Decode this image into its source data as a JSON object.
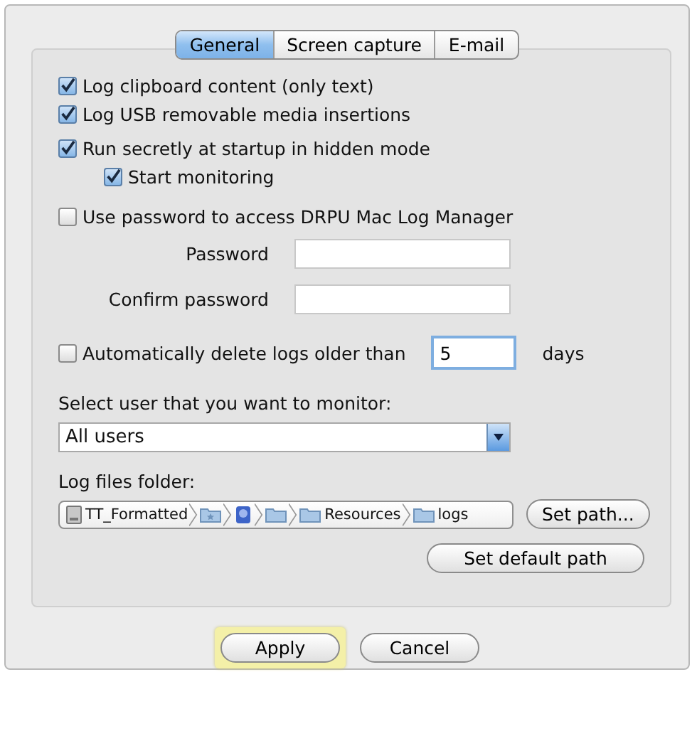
{
  "tabs": [
    {
      "label": "General",
      "selected": true
    },
    {
      "label": "Screen capture",
      "selected": false
    },
    {
      "label": "E-mail",
      "selected": false
    }
  ],
  "options": [
    {
      "label": "Log clipboard content (only text)",
      "checked": true
    },
    {
      "label": "Log USB removable media insertions",
      "checked": true
    },
    {
      "label": "Run secretly at startup in hidden mode",
      "checked": true,
      "children": [
        {
          "label": "Start monitoring",
          "checked": true
        }
      ]
    }
  ],
  "password": {
    "label": "Use password to access DRPU Mac Log Manager",
    "checked": false,
    "fields": [
      {
        "label": "Password"
      },
      {
        "label": "Confirm password"
      }
    ]
  },
  "auto_delete": {
    "label": "Automatically delete logs older than",
    "checked": false,
    "value": "5",
    "unit": "days"
  },
  "user_select": {
    "label": "Select user that you want to monitor:",
    "value": "All users"
  },
  "log_folder": {
    "label": "Log files folder:",
    "path": [
      {
        "kind": "disk",
        "label": "TT_Formatted"
      },
      {
        "kind": "star-folder"
      },
      {
        "kind": "app"
      },
      {
        "kind": "folder"
      },
      {
        "kind": "folder",
        "label": "Resources"
      },
      {
        "kind": "folder",
        "label": "logs"
      }
    ],
    "set_path": "Set path...",
    "set_default": "Set default path"
  },
  "buttons": [
    {
      "label": "Apply",
      "highlighted": true
    },
    {
      "label": "Cancel",
      "highlighted": false
    }
  ]
}
